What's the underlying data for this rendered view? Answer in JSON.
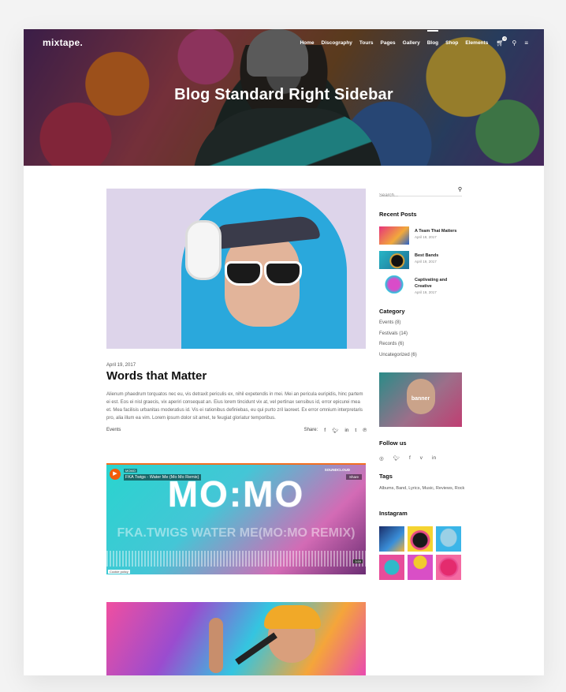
{
  "header": {
    "logo": "mixtape.",
    "nav": [
      "Home",
      "Discography",
      "Tours",
      "Pages",
      "Gallery",
      "Blog",
      "Shop",
      "Elements"
    ],
    "active_nav": "Blog",
    "cart_count": "0",
    "title": "Blog Standard Right Sidebar"
  },
  "post1": {
    "date": "April 19, 2017",
    "title": "Words that Matter",
    "excerpt": "Alienum phaedrum torquatos nec eu, vis detraxit periculis ex, nihil expetendis in mei. Mei an pericula euripidis, hinc partem ei est. Eos ei nisl graecis, vix aperiri consequat an. Eius lorem tincidunt vix at, vel pertinax sensibus id, error epicurei mea et. Mea facilisis urbanitas moderatius id. Vis ei rationibus definiebas, eu qui purto zril laoreet. Ex error omnium interpretaris pro, alia illum ea vim. Lorem ipsum dolor sit amet, te feugiat gloriatur temporibus.",
    "category": "Events",
    "share_label": "Share:"
  },
  "audio": {
    "user": "MOMO",
    "track": "FKA Twigs - Water Me (Mo Mo Remix)",
    "brand": "SOUNDCLOUD",
    "share": "Share",
    "big_text": "MO:MO",
    "sub_text": "FKA.TWIGS WATER ME(MO:MO REMIX)",
    "time": "3:59",
    "cookie": "Cookie policy"
  },
  "sidebar": {
    "search_placeholder": "Search...",
    "recent_title": "Recent Posts",
    "recent": [
      {
        "title": "A Team That Matters",
        "date": "April 19, 2017"
      },
      {
        "title": "Best Bands",
        "date": "April 19, 2017"
      },
      {
        "title": "Captivating and Creative",
        "date": "April 19, 2017"
      }
    ],
    "category_title": "Category",
    "categories": [
      "Events (8)",
      "Festivals (14)",
      "Records (6)",
      "Uncategorized (6)"
    ],
    "banner_text": "banner",
    "follow_title": "Follow us",
    "tags_title": "Tags",
    "tags": "Albums, Band, Lyrics, Music, Reviews, Rock",
    "instagram_title": "Instagram"
  }
}
